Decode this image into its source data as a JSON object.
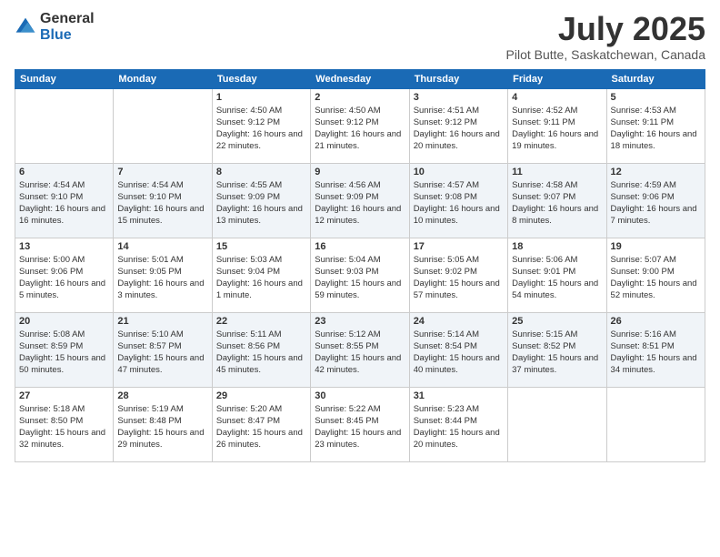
{
  "logo": {
    "general": "General",
    "blue": "Blue"
  },
  "header": {
    "title": "July 2025",
    "subtitle": "Pilot Butte, Saskatchewan, Canada"
  },
  "weekdays": [
    "Sunday",
    "Monday",
    "Tuesday",
    "Wednesday",
    "Thursday",
    "Friday",
    "Saturday"
  ],
  "weeks": [
    [
      {
        "day": "",
        "sunrise": "",
        "sunset": "",
        "daylight": ""
      },
      {
        "day": "",
        "sunrise": "",
        "sunset": "",
        "daylight": ""
      },
      {
        "day": "1",
        "sunrise": "Sunrise: 4:50 AM",
        "sunset": "Sunset: 9:12 PM",
        "daylight": "Daylight: 16 hours and 22 minutes."
      },
      {
        "day": "2",
        "sunrise": "Sunrise: 4:50 AM",
        "sunset": "Sunset: 9:12 PM",
        "daylight": "Daylight: 16 hours and 21 minutes."
      },
      {
        "day": "3",
        "sunrise": "Sunrise: 4:51 AM",
        "sunset": "Sunset: 9:12 PM",
        "daylight": "Daylight: 16 hours and 20 minutes."
      },
      {
        "day": "4",
        "sunrise": "Sunrise: 4:52 AM",
        "sunset": "Sunset: 9:11 PM",
        "daylight": "Daylight: 16 hours and 19 minutes."
      },
      {
        "day": "5",
        "sunrise": "Sunrise: 4:53 AM",
        "sunset": "Sunset: 9:11 PM",
        "daylight": "Daylight: 16 hours and 18 minutes."
      }
    ],
    [
      {
        "day": "6",
        "sunrise": "Sunrise: 4:54 AM",
        "sunset": "Sunset: 9:10 PM",
        "daylight": "Daylight: 16 hours and 16 minutes."
      },
      {
        "day": "7",
        "sunrise": "Sunrise: 4:54 AM",
        "sunset": "Sunset: 9:10 PM",
        "daylight": "Daylight: 16 hours and 15 minutes."
      },
      {
        "day": "8",
        "sunrise": "Sunrise: 4:55 AM",
        "sunset": "Sunset: 9:09 PM",
        "daylight": "Daylight: 16 hours and 13 minutes."
      },
      {
        "day": "9",
        "sunrise": "Sunrise: 4:56 AM",
        "sunset": "Sunset: 9:09 PM",
        "daylight": "Daylight: 16 hours and 12 minutes."
      },
      {
        "day": "10",
        "sunrise": "Sunrise: 4:57 AM",
        "sunset": "Sunset: 9:08 PM",
        "daylight": "Daylight: 16 hours and 10 minutes."
      },
      {
        "day": "11",
        "sunrise": "Sunrise: 4:58 AM",
        "sunset": "Sunset: 9:07 PM",
        "daylight": "Daylight: 16 hours and 8 minutes."
      },
      {
        "day": "12",
        "sunrise": "Sunrise: 4:59 AM",
        "sunset": "Sunset: 9:06 PM",
        "daylight": "Daylight: 16 hours and 7 minutes."
      }
    ],
    [
      {
        "day": "13",
        "sunrise": "Sunrise: 5:00 AM",
        "sunset": "Sunset: 9:06 PM",
        "daylight": "Daylight: 16 hours and 5 minutes."
      },
      {
        "day": "14",
        "sunrise": "Sunrise: 5:01 AM",
        "sunset": "Sunset: 9:05 PM",
        "daylight": "Daylight: 16 hours and 3 minutes."
      },
      {
        "day": "15",
        "sunrise": "Sunrise: 5:03 AM",
        "sunset": "Sunset: 9:04 PM",
        "daylight": "Daylight: 16 hours and 1 minute."
      },
      {
        "day": "16",
        "sunrise": "Sunrise: 5:04 AM",
        "sunset": "Sunset: 9:03 PM",
        "daylight": "Daylight: 15 hours and 59 minutes."
      },
      {
        "day": "17",
        "sunrise": "Sunrise: 5:05 AM",
        "sunset": "Sunset: 9:02 PM",
        "daylight": "Daylight: 15 hours and 57 minutes."
      },
      {
        "day": "18",
        "sunrise": "Sunrise: 5:06 AM",
        "sunset": "Sunset: 9:01 PM",
        "daylight": "Daylight: 15 hours and 54 minutes."
      },
      {
        "day": "19",
        "sunrise": "Sunrise: 5:07 AM",
        "sunset": "Sunset: 9:00 PM",
        "daylight": "Daylight: 15 hours and 52 minutes."
      }
    ],
    [
      {
        "day": "20",
        "sunrise": "Sunrise: 5:08 AM",
        "sunset": "Sunset: 8:59 PM",
        "daylight": "Daylight: 15 hours and 50 minutes."
      },
      {
        "day": "21",
        "sunrise": "Sunrise: 5:10 AM",
        "sunset": "Sunset: 8:57 PM",
        "daylight": "Daylight: 15 hours and 47 minutes."
      },
      {
        "day": "22",
        "sunrise": "Sunrise: 5:11 AM",
        "sunset": "Sunset: 8:56 PM",
        "daylight": "Daylight: 15 hours and 45 minutes."
      },
      {
        "day": "23",
        "sunrise": "Sunrise: 5:12 AM",
        "sunset": "Sunset: 8:55 PM",
        "daylight": "Daylight: 15 hours and 42 minutes."
      },
      {
        "day": "24",
        "sunrise": "Sunrise: 5:14 AM",
        "sunset": "Sunset: 8:54 PM",
        "daylight": "Daylight: 15 hours and 40 minutes."
      },
      {
        "day": "25",
        "sunrise": "Sunrise: 5:15 AM",
        "sunset": "Sunset: 8:52 PM",
        "daylight": "Daylight: 15 hours and 37 minutes."
      },
      {
        "day": "26",
        "sunrise": "Sunrise: 5:16 AM",
        "sunset": "Sunset: 8:51 PM",
        "daylight": "Daylight: 15 hours and 34 minutes."
      }
    ],
    [
      {
        "day": "27",
        "sunrise": "Sunrise: 5:18 AM",
        "sunset": "Sunset: 8:50 PM",
        "daylight": "Daylight: 15 hours and 32 minutes."
      },
      {
        "day": "28",
        "sunrise": "Sunrise: 5:19 AM",
        "sunset": "Sunset: 8:48 PM",
        "daylight": "Daylight: 15 hours and 29 minutes."
      },
      {
        "day": "29",
        "sunrise": "Sunrise: 5:20 AM",
        "sunset": "Sunset: 8:47 PM",
        "daylight": "Daylight: 15 hours and 26 minutes."
      },
      {
        "day": "30",
        "sunrise": "Sunrise: 5:22 AM",
        "sunset": "Sunset: 8:45 PM",
        "daylight": "Daylight: 15 hours and 23 minutes."
      },
      {
        "day": "31",
        "sunrise": "Sunrise: 5:23 AM",
        "sunset": "Sunset: 8:44 PM",
        "daylight": "Daylight: 15 hours and 20 minutes."
      },
      {
        "day": "",
        "sunrise": "",
        "sunset": "",
        "daylight": ""
      },
      {
        "day": "",
        "sunrise": "",
        "sunset": "",
        "daylight": ""
      }
    ]
  ]
}
